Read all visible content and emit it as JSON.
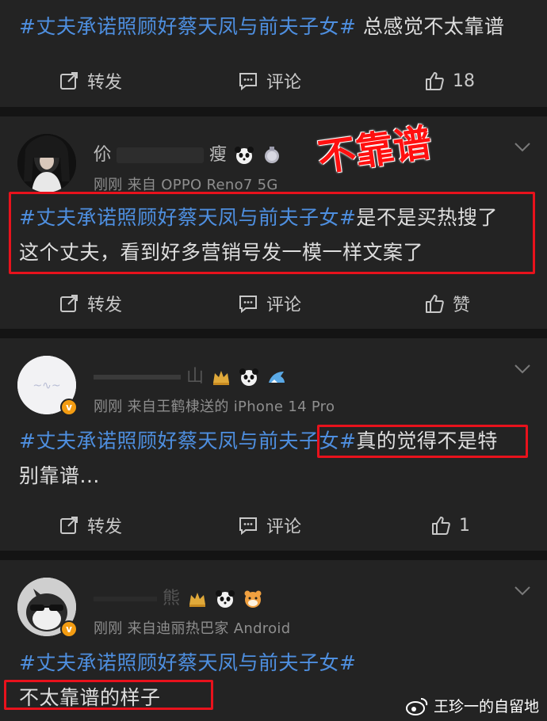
{
  "posts": [
    {
      "text_hashtag": "#丈夫承诺照顾好蔡天凤与前夫子女#",
      "text_body": " 总感觉不太靠谱",
      "actions": {
        "repost": "转发",
        "comment": "评论",
        "like": "18"
      }
    },
    {
      "username_left": "伱",
      "username_right": "瘦",
      "meta": "刚刚  来自 OPPO Reno7 5G",
      "text_hashtag": "#丈夫承诺照顾好蔡天凤与前夫子女#",
      "text_body_1": "是不是买热搜了",
      "text_body_2": "这个丈夫，看到好多营销号发一模一样文案了",
      "actions": {
        "repost": "转发",
        "comment": "评论",
        "like": "赞"
      }
    },
    {
      "username_right": "山",
      "meta": "刚刚  来自王鹤棣送的 iPhone 14 Pro",
      "text_hashtag": "#丈夫承诺照顾好蔡天凤与前夫子女#",
      "text_body_1": "真的觉得不是特",
      "text_body_2": "别靠谱...",
      "actions": {
        "repost": "转发",
        "comment": "评论",
        "like": "1"
      }
    },
    {
      "username_right": "熊",
      "meta": "刚刚  来自迪丽热巴家 Android",
      "text_hashtag": "#丈夫承诺照顾好蔡天凤与前夫子女#",
      "text_body_2": "不太靠谱的样子"
    }
  ],
  "annotation": "不靠谱",
  "watermark": "王珍一的自留地",
  "colors": {
    "hashtag": "#4e8fe0",
    "highlight_box": "#e8121c",
    "stamp": "#ff1010",
    "background": "#232323"
  }
}
